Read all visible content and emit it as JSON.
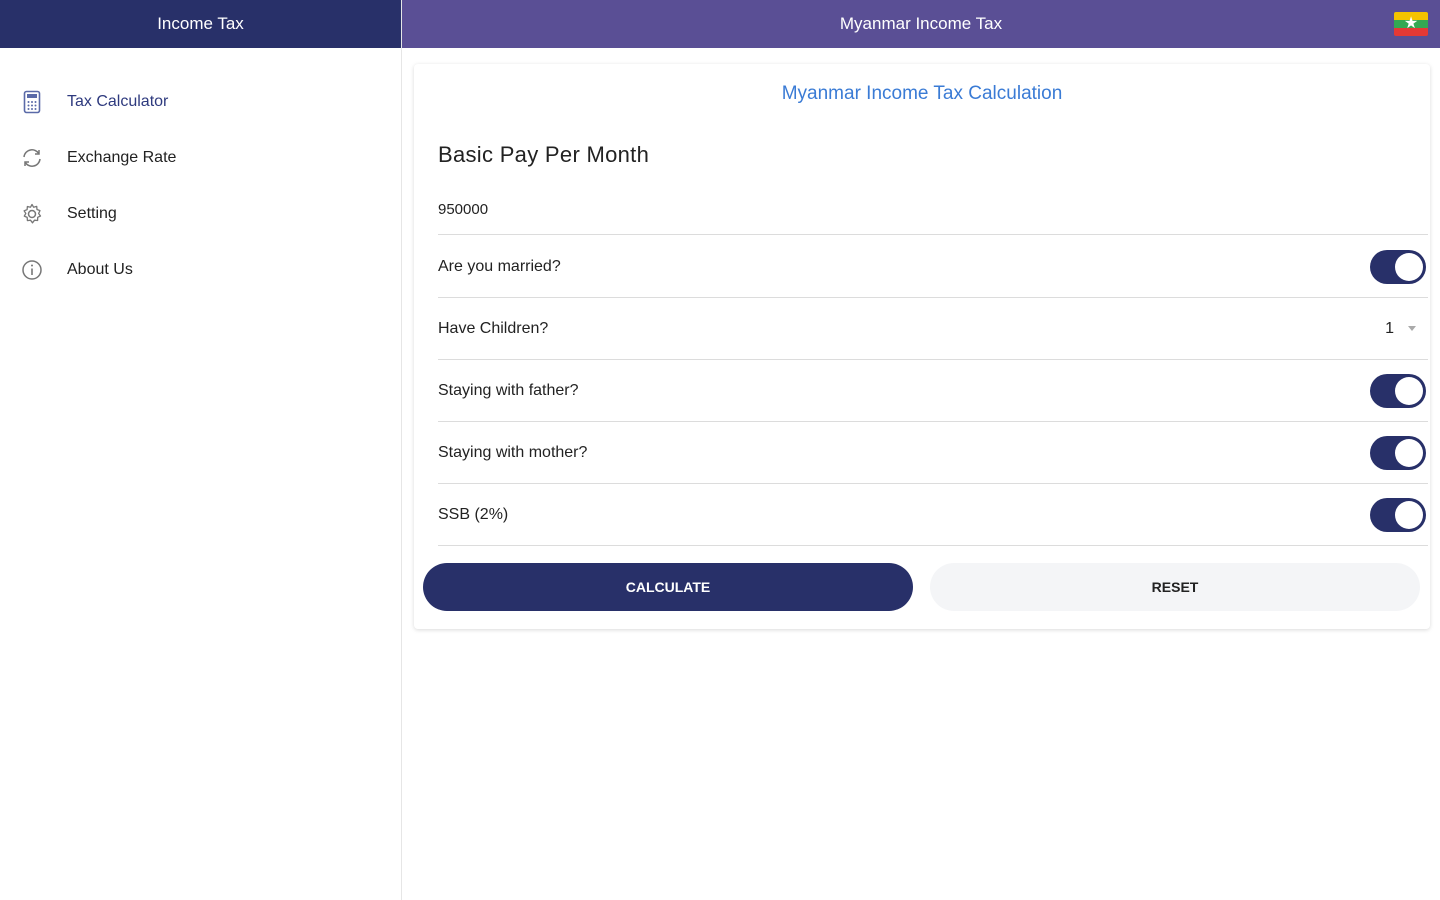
{
  "sidebar": {
    "title": "Income Tax",
    "items": [
      {
        "label": "Tax Calculator",
        "icon": "calculator-icon"
      },
      {
        "label": "Exchange Rate",
        "icon": "exchange-icon"
      },
      {
        "label": "Setting",
        "icon": "gear-icon"
      },
      {
        "label": "About Us",
        "icon": "info-icon"
      }
    ]
  },
  "topbar": {
    "title": "Myanmar Income Tax",
    "flag_icon": "myanmar-flag-icon"
  },
  "card": {
    "title": "Myanmar Income Tax Calculation",
    "basic_pay_label": "Basic Pay Per Month",
    "basic_pay_value": "950000",
    "married_label": "Are you married?",
    "married_on": true,
    "children_label": "Have Children?",
    "children_value": "1",
    "father_label": "Staying with father?",
    "father_on": true,
    "mother_label": "Staying with mother?",
    "mother_on": true,
    "ssb_label": "SSB (2%)",
    "ssb_on": true,
    "calculate_label": "CALCULATE",
    "reset_label": "RESET"
  },
  "colors": {
    "primary": "#283069",
    "topbar": "#5a4f95",
    "accent_text": "#3a7bd5"
  }
}
